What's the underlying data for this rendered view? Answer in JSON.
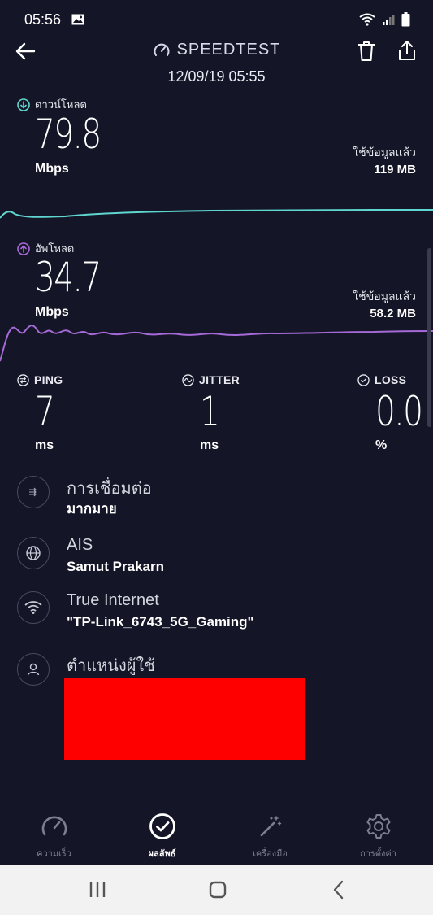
{
  "status_bar": {
    "time": "05:56",
    "icons": [
      "image-icon",
      "wifi-icon",
      "signal-icon",
      "battery-icon"
    ]
  },
  "header": {
    "title": "SPEEDTEST",
    "date": "12/09/19 05:55"
  },
  "download": {
    "label": "ดาวน์โหลด",
    "value": "79.8",
    "unit": "Mbps",
    "data_used_label": "ใช้ข้อมูลแล้ว",
    "data_used_value": "119 MB",
    "color": "#5fd6cf"
  },
  "upload": {
    "label": "อัพโหลด",
    "value": "34.7",
    "unit": "Mbps",
    "data_used_label": "ใช้ข้อมูลแล้ว",
    "data_used_value": "58.2 MB",
    "color": "#a66ad8"
  },
  "metrics": {
    "ping": {
      "label": "PING",
      "value": "7",
      "unit": "ms"
    },
    "jitter": {
      "label": "JITTER",
      "value": "1",
      "unit": "ms"
    },
    "loss": {
      "label": "LOSS",
      "value": "0.0",
      "unit": "%"
    }
  },
  "info": {
    "connection": {
      "title": "การเชื่อมต่อ",
      "value": "มากมาย"
    },
    "server": {
      "title": "AIS",
      "value": "Samut Prakarn"
    },
    "provider": {
      "title": "True Internet",
      "value": "\"TP-Link_6743_5G_Gaming\""
    },
    "location": {
      "title": "ตำแหน่งผู้ใช้"
    }
  },
  "bottom_nav": {
    "items": [
      {
        "label": "ความเร็ว",
        "icon": "speedometer-icon",
        "active": false
      },
      {
        "label": "ผลลัพธ์",
        "icon": "check-circle-icon",
        "active": true
      },
      {
        "label": "เครื่องมือ",
        "icon": "magic-wand-icon",
        "active": false
      },
      {
        "label": "การตั้งค่า",
        "icon": "gear-icon",
        "active": false
      }
    ]
  },
  "colors": {
    "background": "#141526",
    "download": "#5fd6cf",
    "upload": "#a66ad8"
  }
}
